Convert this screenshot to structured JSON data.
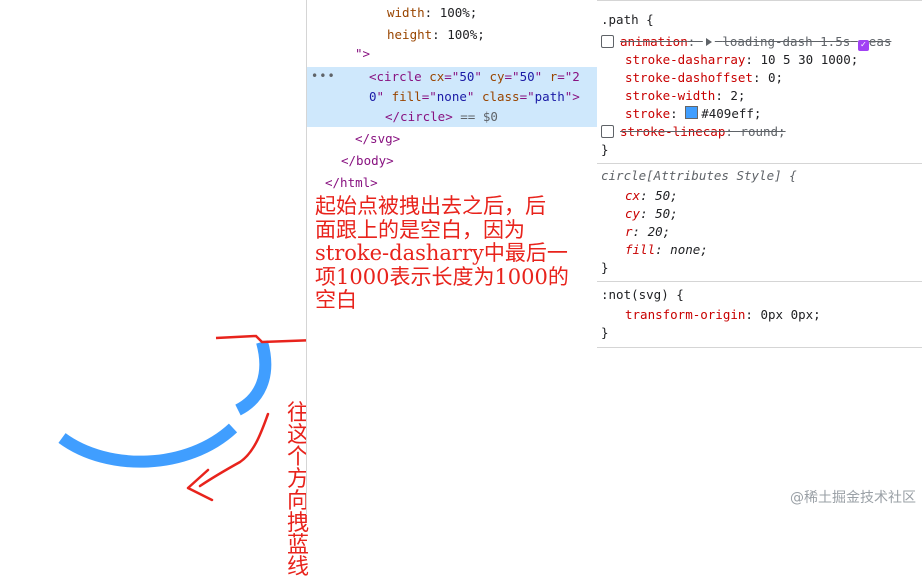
{
  "elements": {
    "lines": [
      {
        "html_parts": [
          {
            "c": "attr",
            "t": "width"
          },
          {
            "c": "",
            "t": ": 100%;"
          }
        ],
        "indent": 80
      },
      {
        "html_parts": [
          {
            "c": "attr",
            "t": "height"
          },
          {
            "c": "",
            "t": ": 100%;"
          }
        ],
        "indent": 80
      },
      {
        "html_parts": [
          {
            "c": "tag",
            "t": "\">"
          }
        ],
        "indent": 48
      },
      {
        "html_parts": [
          {
            "c": "tag",
            "t": "<circle "
          },
          {
            "c": "attr",
            "t": "cx"
          },
          {
            "c": "tag",
            "t": "=\""
          },
          {
            "c": "val",
            "t": "50"
          },
          {
            "c": "tag",
            "t": "\" "
          },
          {
            "c": "attr",
            "t": "cy"
          },
          {
            "c": "tag",
            "t": "=\""
          },
          {
            "c": "val",
            "t": "50"
          },
          {
            "c": "tag",
            "t": "\" "
          },
          {
            "c": "attr",
            "t": "r"
          },
          {
            "c": "tag",
            "t": "=\"2"
          }
        ],
        "indent": 62,
        "selected": true,
        "ellipsis": "•••"
      },
      {
        "html_parts": [
          {
            "c": "val",
            "t": "0"
          },
          {
            "c": "tag",
            "t": "\" "
          },
          {
            "c": "attr",
            "t": "fill"
          },
          {
            "c": "tag",
            "t": "=\""
          },
          {
            "c": "val",
            "t": "none"
          },
          {
            "c": "tag",
            "t": "\" "
          },
          {
            "c": "attr",
            "t": "class"
          },
          {
            "c": "tag",
            "t": "=\""
          },
          {
            "c": "val",
            "t": "path"
          },
          {
            "c": "tag",
            "t": "\">"
          }
        ],
        "indent": 62,
        "selected": true
      },
      {
        "html_parts": [
          {
            "c": "tag",
            "t": "</circle>"
          },
          {
            "c": "muted",
            "t": " == $0"
          }
        ],
        "indent": 78,
        "selected": true
      },
      {
        "html_parts": [
          {
            "c": "tag",
            "t": "</svg>"
          }
        ],
        "indent": 48
      },
      {
        "html_parts": [
          {
            "c": "tag",
            "t": "</body>"
          }
        ],
        "indent": 34
      },
      {
        "html_parts": [
          {
            "c": "tag",
            "t": "</html>"
          }
        ],
        "indent": 18
      }
    ]
  },
  "styles": {
    "path_rule": {
      "selector": ".path {",
      "animation_prop": "animation",
      "animation_value": "loading-dash 1.5s",
      "animation_tail": "eas",
      "dasharray_prop": "stroke-dasharray",
      "dasharray_value": "10 5 30 1000;",
      "dashoffset_prop": "stroke-dashoffset",
      "dashoffset_value": "0;",
      "width_prop": "stroke-width",
      "width_value": "2;",
      "stroke_prop": "stroke",
      "stroke_value": "#409eff;",
      "linecap_prop": "stroke-linecap",
      "linecap_value": "round;",
      "close": "}"
    },
    "attr_rule": {
      "selector": "circle[Attributes Style] {",
      "cx_prop": "cx",
      "cx_value": "50;",
      "cy_prop": "cy",
      "cy_value": "50;",
      "r_prop": "r",
      "r_value": "20;",
      "fill_prop": "fill",
      "fill_value": "none;",
      "close": "}"
    },
    "not_rule": {
      "selector": ":not(svg) {",
      "origin_prop": "transform-origin",
      "origin_value": "0px 0px;",
      "close": "}"
    }
  },
  "annotations": {
    "note1": [
      "起始点被拽出去之后，后",
      "面跟上的是空白，因为",
      "stroke-dasharry中最后一",
      "项1000表示长度为1000的",
      "空白"
    ],
    "note2": "往这个方向拽蓝线"
  },
  "watermark": "@稀土掘金技术社区",
  "colors": {
    "stroke": "#409eff",
    "annotation": "#e8231c",
    "selected_bg": "#cfe8fc"
  }
}
